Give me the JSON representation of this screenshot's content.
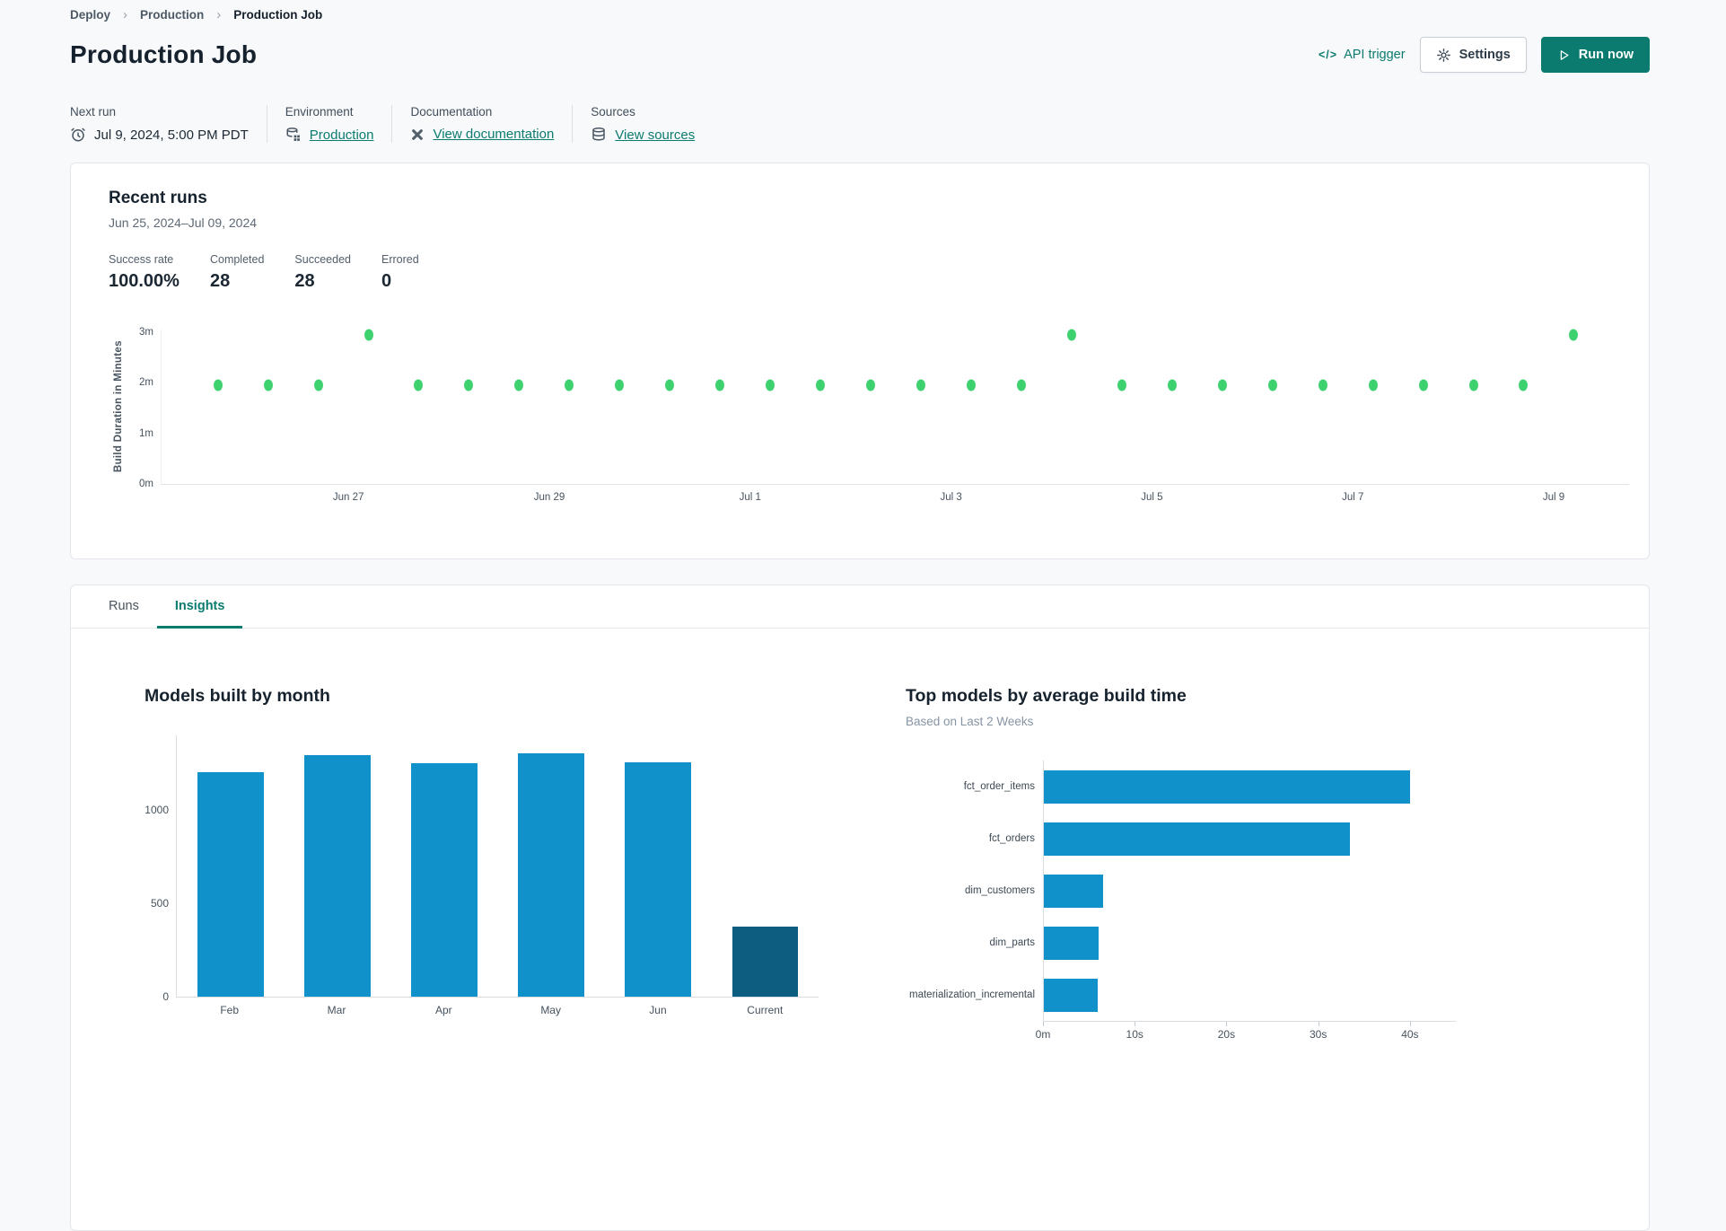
{
  "breadcrumb": {
    "items": [
      "Deploy",
      "Production",
      "Production Job"
    ]
  },
  "page": {
    "title": "Production Job"
  },
  "header_actions": {
    "api_trigger_label": "API trigger",
    "api_trigger_glyph": "</>",
    "settings_label": "Settings",
    "run_now_label": "Run now"
  },
  "info_bar": [
    {
      "label": "Next run",
      "value": "Jul 9, 2024, 5:00 PM PDT",
      "icon": "clock-icon",
      "is_link": false
    },
    {
      "label": "Environment",
      "value": "Production",
      "icon": "database-grid-icon",
      "is_link": true
    },
    {
      "label": "Documentation",
      "value": "View documentation",
      "icon": "dbt-logo-icon",
      "is_link": true
    },
    {
      "label": "Sources",
      "value": "View sources",
      "icon": "database-icon",
      "is_link": true
    }
  ],
  "recent_runs": {
    "title": "Recent runs",
    "date_range": "Jun 25, 2024–Jul 09, 2024",
    "stats": [
      {
        "label": "Success rate",
        "value": "100.00%"
      },
      {
        "label": "Completed",
        "value": "28"
      },
      {
        "label": "Succeeded",
        "value": "28"
      },
      {
        "label": "Errored",
        "value": "0"
      }
    ]
  },
  "tabs": [
    {
      "label": "Runs",
      "active": false
    },
    {
      "label": "Insights",
      "active": true
    }
  ],
  "colors": {
    "accent_teal": "#0b7b6f",
    "scatter_green": "#3ed16f",
    "bar_blue": "#1191c9",
    "bar_dark_blue": "#0d5d81"
  },
  "chart_data": [
    {
      "id": "build-duration-scatter",
      "type": "scatter",
      "ylabel": "Build Duration in Minutes",
      "x_unit": "days since Jun 25, 2024 (2 runs per day)",
      "x_domain": [
        0.14,
        14.75
      ],
      "ylim": [
        0,
        3.05
      ],
      "grid": false,
      "y_ticks": [
        {
          "v": 0,
          "label": "0m"
        },
        {
          "v": 1,
          "label": "1m"
        },
        {
          "v": 2,
          "label": "2m"
        },
        {
          "v": 3,
          "label": "3m"
        }
      ],
      "x_ticks": [
        {
          "v": 2,
          "label": "Jun 27"
        },
        {
          "v": 4,
          "label": "Jun 29"
        },
        {
          "v": 6,
          "label": "Jul 1"
        },
        {
          "v": 8,
          "label": "Jul 3"
        },
        {
          "v": 10,
          "label": "Jul 5"
        },
        {
          "v": 12,
          "label": "Jul 7"
        },
        {
          "v": 14,
          "label": "Jul 9"
        }
      ],
      "points": [
        {
          "x": 0.7,
          "y": 1.95
        },
        {
          "x": 1.2,
          "y": 1.95
        },
        {
          "x": 1.7,
          "y": 1.95
        },
        {
          "x": 2.2,
          "y": 2.95
        },
        {
          "x": 2.7,
          "y": 1.95
        },
        {
          "x": 3.2,
          "y": 1.95
        },
        {
          "x": 3.7,
          "y": 1.95
        },
        {
          "x": 4.2,
          "y": 1.95
        },
        {
          "x": 4.7,
          "y": 1.95
        },
        {
          "x": 5.2,
          "y": 1.95
        },
        {
          "x": 5.7,
          "y": 1.95
        },
        {
          "x": 6.2,
          "y": 1.95
        },
        {
          "x": 6.7,
          "y": 1.95
        },
        {
          "x": 7.2,
          "y": 1.95
        },
        {
          "x": 7.7,
          "y": 1.95
        },
        {
          "x": 8.2,
          "y": 1.95
        },
        {
          "x": 8.7,
          "y": 1.95
        },
        {
          "x": 9.2,
          "y": 2.95
        },
        {
          "x": 9.7,
          "y": 1.95
        },
        {
          "x": 10.2,
          "y": 1.95
        },
        {
          "x": 10.7,
          "y": 1.95
        },
        {
          "x": 11.2,
          "y": 1.95
        },
        {
          "x": 11.7,
          "y": 1.95
        },
        {
          "x": 12.2,
          "y": 1.95
        },
        {
          "x": 12.7,
          "y": 1.95
        },
        {
          "x": 13.2,
          "y": 1.95
        },
        {
          "x": 13.7,
          "y": 1.95
        },
        {
          "x": 14.2,
          "y": 2.95
        }
      ]
    },
    {
      "id": "models-built-by-month",
      "type": "bar",
      "title": "Models built by month",
      "categories": [
        "Feb",
        "Mar",
        "Apr",
        "May",
        "Jun",
        "Current"
      ],
      "values": [
        1205,
        1295,
        1250,
        1305,
        1255,
        375
      ],
      "ylim": [
        0,
        1400
      ],
      "y_ticks": [
        0,
        500,
        1000
      ],
      "grid": false,
      "highlight_last": true
    },
    {
      "id": "top-models-by-build-time",
      "type": "horizontal_bar",
      "title": "Top models by average build time",
      "subtitle": "Based on Last 2 Weeks",
      "categories": [
        "fct_order_items",
        "fct_orders",
        "dim_customers",
        "dim_parts",
        "materialization_incremental"
      ],
      "values_seconds": [
        39.9,
        33.4,
        6.5,
        6.0,
        5.9
      ],
      "xlim": [
        0,
        45
      ],
      "x_ticks": [
        {
          "v": 0,
          "label": "0m"
        },
        {
          "v": 10,
          "label": "10s"
        },
        {
          "v": 20,
          "label": "20s"
        },
        {
          "v": 30,
          "label": "30s"
        },
        {
          "v": 40,
          "label": "40s"
        }
      ],
      "grid": false
    }
  ]
}
